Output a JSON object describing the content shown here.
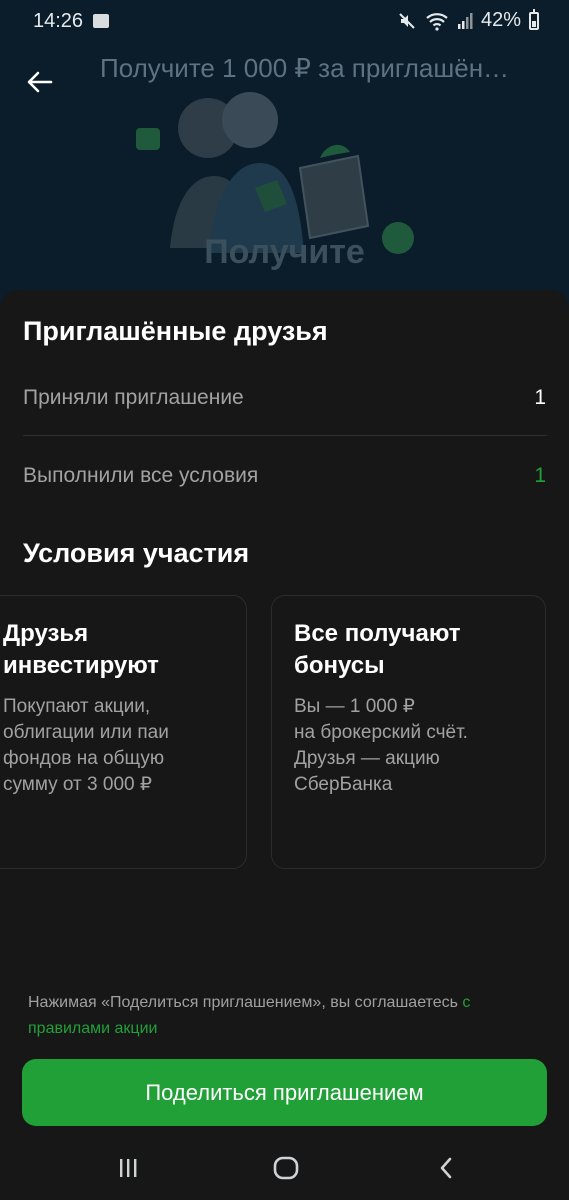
{
  "status_bar": {
    "time": "14:26",
    "battery": "42%",
    "battery_level": 0.42
  },
  "header": {
    "title": "Получите 1 000 ₽ за приглашён…",
    "promo_title": "Получите"
  },
  "invited": {
    "title": "Приглашённые друзья",
    "rows": [
      {
        "label": "Приняли приглашение",
        "value": "1"
      },
      {
        "label": "Выполнили все условия",
        "value": "1"
      }
    ]
  },
  "conditions": {
    "title": "Условия участия",
    "cards": [
      {
        "title": "Друзья\nинвестируют",
        "text": "Покупают акции,\nоблигации или паи\nфондов на общую\nсумму от 3 000 ₽"
      },
      {
        "title": "Все получают\nбонусы",
        "text": "Вы — 1 000 ₽\nна брокерский счёт.\nДрузья — акцию\nСберБанка"
      }
    ]
  },
  "consent": {
    "text": "Нажимая «Поделиться приглашением», вы соглашаетесь ",
    "link": "с правилами акции"
  },
  "share_button": "Поделиться приглашением",
  "colors": {
    "accent": "#21a038",
    "sheet": "#171717",
    "background": "#0b1d2a"
  }
}
